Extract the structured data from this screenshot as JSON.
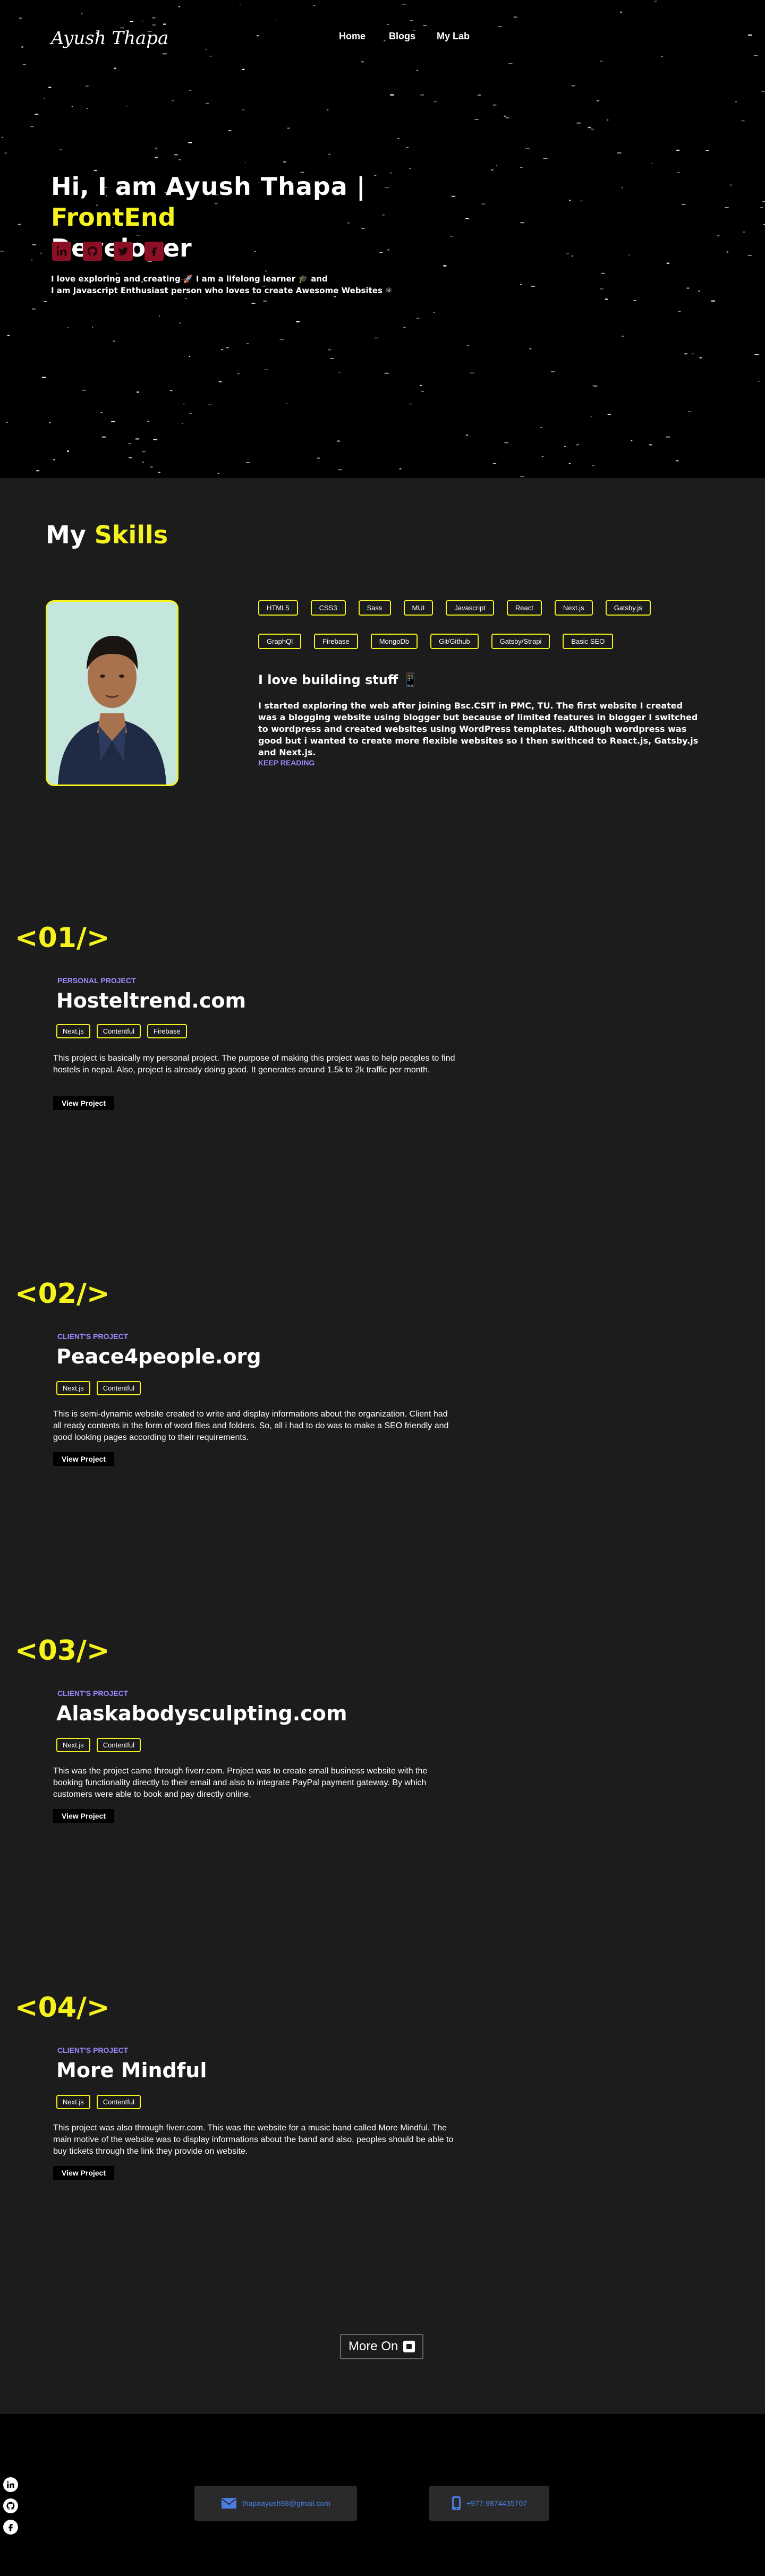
{
  "nav": {
    "logo": "Ayush Thapa",
    "links": [
      "Home",
      "Blogs",
      "My Lab"
    ]
  },
  "hero": {
    "greeting": "Hi, I am ",
    "name": "Ayush Thapa",
    "separator": " | ",
    "role_highlight": "FrontEnd",
    "role_rest": "Developer",
    "desc_line1": "I love exploring and creating 🚀 I am a lifelong learner 🎓 and",
    "desc_line2": "I am Javascript Enthusiast person who loves to create Awesome Websites ⚛",
    "social_icons": [
      "linkedin-icon",
      "github-icon",
      "twitter-icon",
      "facebook-icon"
    ],
    "social_color": "#8b1025"
  },
  "skills": {
    "heading_prefix": "My ",
    "heading_highlight": "Skills",
    "tags": [
      "HTML5",
      "CSS3",
      "Sass",
      "MUI",
      "Javascript",
      "React",
      "Next.js",
      "Gatsby.js",
      "GraphQl",
      "Firebase",
      "MongoDb",
      "Git/Github",
      "Gatsby/Strapi",
      "Basic SEO"
    ],
    "build_title": "I love building stuff 📱",
    "build_text": "I started exploring the web after joining Bsc.CSIT in PMC, TU. The first website I created was a blogging website using blogger but because of limited features in blogger I switched to wordpress and created websites using WordPress templates. Although wordpress was good but i wanted to create more flexible websites so I then swithced to React.js, Gatsby.js and Next.js.",
    "keep_reading": "KEEP READING"
  },
  "projects": [
    {
      "num": "<01/>",
      "type": "PERSONAL PROJECT",
      "title": "Hosteltrend.com",
      "tags": [
        "Next.js",
        "Contentful",
        "Firebase"
      ],
      "desc": "This project is basically my personal project. The purpose of making this project was to help peoples to find hostels in nepal. Also, project is already doing good. It generates around 1.5k to 2k traffic per month.",
      "button": "View Project"
    },
    {
      "num": "<02/>",
      "type": "CLIENT'S PROJECT",
      "title": "Peace4people.org",
      "tags": [
        "Next.js",
        "Contentful"
      ],
      "desc": "This is semi-dynamic website created to write and display informations about the organization. Client had all ready contents in the form of word files and folders. So, all i had to do was to make a SEO friendly and good looking pages according to their requirements.",
      "button": "View Project"
    },
    {
      "num": "<03/>",
      "type": "CLIENT'S PROJECT",
      "title": "Alaskabodysculpting.com",
      "tags": [
        "Next.js",
        "Contentful"
      ],
      "desc": "This was the project came through fiverr.com. Project was to create small business website with the booking functionality directly to their email and also to integrate PayPal payment gateway. By which customers were able to book and pay directly online.",
      "button": "View Project"
    },
    {
      "num": "<04/>",
      "type": "CLIENT'S PROJECT",
      "title": "More Mindful",
      "tags": [
        "Next.js",
        "Contentful"
      ],
      "desc": "This project was also through fiverr.com. This was the website for a music band called More Mindful. The main motive of the website was to display informations about the band and also, peoples should be able to buy tickets through the link they provide on website.",
      "button": "View Project"
    }
  ],
  "more_button": "More On",
  "footer": {
    "icons": [
      "linkedin-icon",
      "github-icon",
      "facebook-icon"
    ],
    "email": "thapaayush98@gmail.com",
    "phone": "+977-9874435707",
    "link_color": "#4a7de2"
  },
  "colors": {
    "accent": "#f5f21c",
    "label_purple": "#9b8bff",
    "background": "#1c1c1c",
    "hero_background": "#000000"
  }
}
